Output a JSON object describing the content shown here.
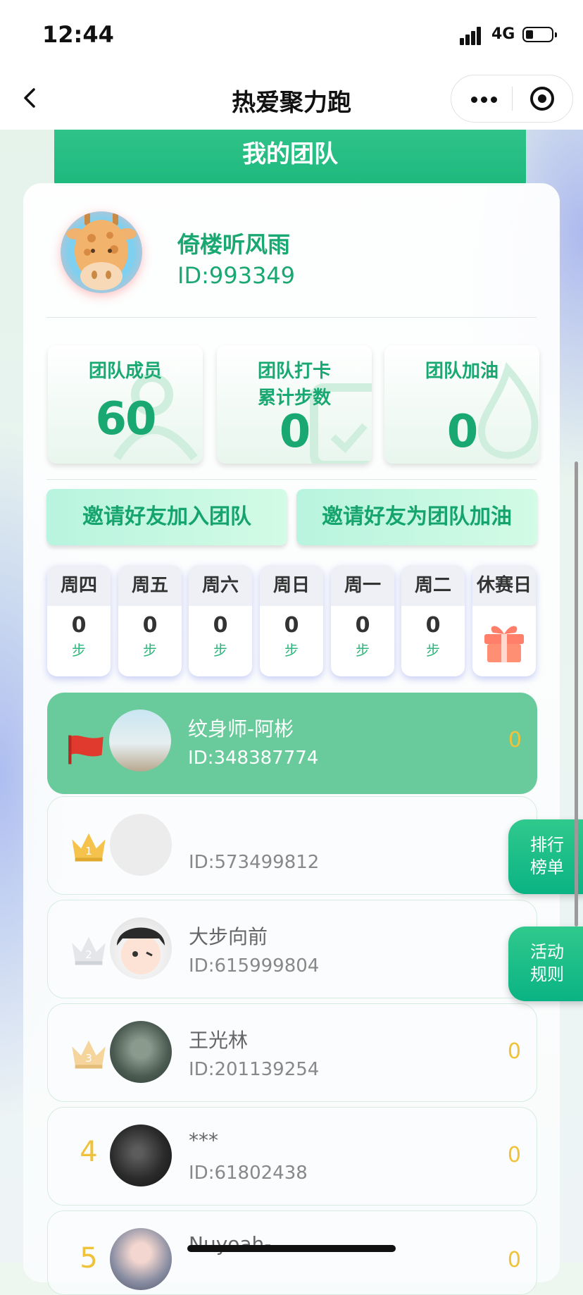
{
  "status_bar": {
    "time": "12:44",
    "network": "4G",
    "battery_icon": "battery-low-icon"
  },
  "nav": {
    "title": "热爱聚力跑",
    "back_icon": "chevron-left-icon",
    "more_icon": "more-dots-icon",
    "close_icon": "target-circle-icon"
  },
  "header": {
    "title": "我的团队"
  },
  "profile": {
    "name": "倚楼听风雨",
    "id": "ID:993349",
    "avatar_icon": "giraffe-avatar"
  },
  "stats": [
    {
      "label": "团队成员",
      "value": "60"
    },
    {
      "label": "团队打卡\n累计步数",
      "value": "0"
    },
    {
      "label": "团队加油",
      "value": "0"
    }
  ],
  "buttons": {
    "invite_join": "邀请好友加入团队",
    "invite_cheer": "邀请好友为团队加油"
  },
  "days": [
    {
      "name": "周四",
      "value": "0",
      "unit": "步"
    },
    {
      "name": "周五",
      "value": "0",
      "unit": "步"
    },
    {
      "name": "周六",
      "value": "0",
      "unit": "步"
    },
    {
      "name": "周日",
      "value": "0",
      "unit": "步"
    },
    {
      "name": "周一",
      "value": "0",
      "unit": "步"
    },
    {
      "name": "周二",
      "value": "0",
      "unit": "步"
    },
    {
      "name": "休赛日",
      "icon": "gift-icon"
    }
  ],
  "ranking": [
    {
      "rank": "flag",
      "name": "纹身师-阿彬",
      "id": "ID:348387774",
      "score": "0"
    },
    {
      "rank": "1",
      "name": "",
      "id": "ID:573499812",
      "score": ""
    },
    {
      "rank": "2",
      "name": "大步向前",
      "id": "ID:615999804",
      "score": ""
    },
    {
      "rank": "3",
      "name": "王光林",
      "id": "ID:201139254",
      "score": "0"
    },
    {
      "rank": "4",
      "name": "***",
      "id": "ID:61802438",
      "score": "0"
    },
    {
      "rank": "5",
      "name": "Nuyoah-",
      "id": "",
      "score": "0"
    }
  ],
  "floating": {
    "leaderboard": "排行\n榜单",
    "rules": "活动\n规则"
  },
  "colors": {
    "primary_green": "#1aa872",
    "gold": "#f0c23a",
    "me_row": "#69cb9b"
  }
}
